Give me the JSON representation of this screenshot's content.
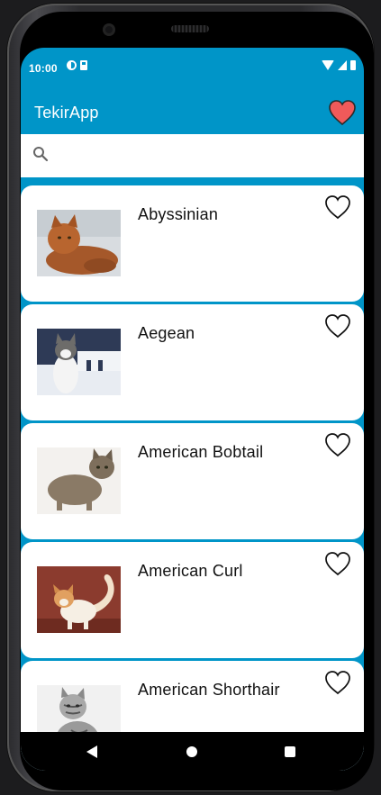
{
  "status_bar": {
    "time": "10:00"
  },
  "app_bar": {
    "title": "TekirApp"
  },
  "search": {
    "placeholder": "",
    "value": ""
  },
  "breeds": [
    {
      "name": "Abyssinian"
    },
    {
      "name": "Aegean"
    },
    {
      "name": "American Bobtail"
    },
    {
      "name": "American Curl"
    },
    {
      "name": "American Shorthair"
    }
  ],
  "colors": {
    "primary": "#0095c8",
    "favorite_heart": "#f05a5a",
    "card": "#ffffff",
    "nav_bar": "#000000"
  },
  "icons": [
    "favorites-heart-icon",
    "search-icon",
    "heart-outline-icon",
    "back-icon",
    "home-icon",
    "recents-icon"
  ]
}
